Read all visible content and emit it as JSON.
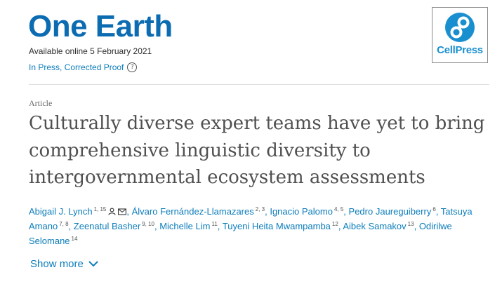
{
  "journal": {
    "title": "One Earth",
    "available_online": "Available online 5 February 2021",
    "status": "In Press, Corrected Proof",
    "help_icon": "?"
  },
  "publisher": {
    "logo_text": "CellPress",
    "icon": "cellpress-logo-icon"
  },
  "article": {
    "type": "Article",
    "title": "Culturally diverse expert teams have yet to bring comprehensive linguistic diversity to intergovernmental ecosystem assessments"
  },
  "authors": [
    {
      "name": "Abigail J. Lynch",
      "affil": "1, 15",
      "contact_icons": true
    },
    {
      "name": "Álvaro Fernández-Llamazares",
      "affil": "2, 3"
    },
    {
      "name": "Ignacio Palomo",
      "affil": "4, 5"
    },
    {
      "name": "Pedro Jaureguiberry",
      "affil": "6"
    },
    {
      "name": "Tatsuya Amano",
      "affil": "7, 8"
    },
    {
      "name": "Zeenatul Basher",
      "affil": "9, 10"
    },
    {
      "name": "Michelle Lim",
      "affil": "11"
    },
    {
      "name": "Tuyeni Heita Mwampamba",
      "affil": "12"
    },
    {
      "name": "Aibek Samakov",
      "affil": "13"
    },
    {
      "name": "Odirilwe Selomane",
      "affil": "14"
    }
  ],
  "show_more": {
    "label": "Show more"
  },
  "colors": {
    "brand": "#0c6cb1",
    "link": "#0c7dbb",
    "title_text": "#505050"
  }
}
